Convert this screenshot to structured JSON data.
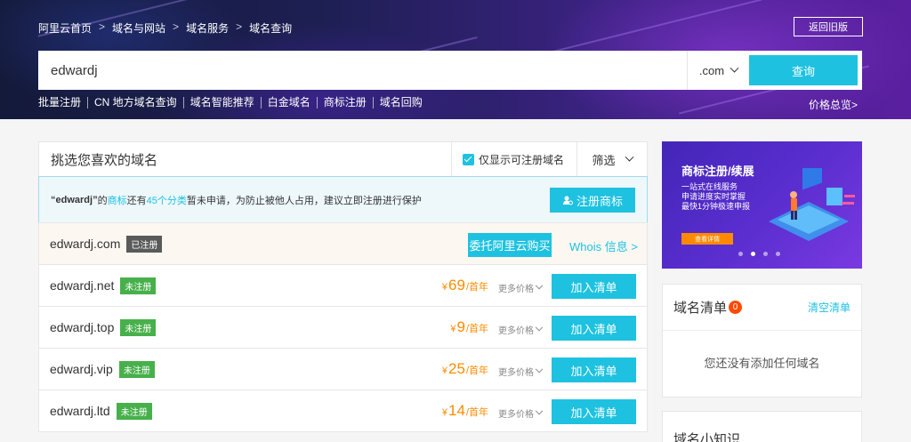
{
  "breadcrumb": [
    "阿里云首页",
    "域名与网站",
    "域名服务",
    "域名查询"
  ],
  "breadcrumb_sep": ">",
  "old_version_label": "返回旧版",
  "search": {
    "value": "edwardj",
    "tld": ".com",
    "button": "查询"
  },
  "quick_links": [
    "批量注册",
    "CN 地方域名查询",
    "域名智能推荐",
    "白金域名",
    "商标注册",
    "域名回购"
  ],
  "price_overview": "价格总览>",
  "filter": {
    "title": "挑选您喜欢的域名",
    "only_available": "仅显示可注册域名",
    "filter_label": "筛选"
  },
  "notice": {
    "quote": "“edwardj”",
    "t1": "的",
    "link1": "商标",
    "t2": "还有",
    "link2": "45个分类",
    "t3": "暂未申请，为防止被他人占用，建议立即注册进行保护",
    "button": "注册商标"
  },
  "taken_row": {
    "domain": "edwardj.com",
    "tag": "已注册",
    "entrust": "委托阿里云购买",
    "whois": "Whois 信息 >"
  },
  "rows": [
    {
      "domain": "edwardj.net",
      "tag": "未注册",
      "currency": "¥",
      "price": "69",
      "unit": "/首年",
      "more": "更多价格",
      "add": "加入清单"
    },
    {
      "domain": "edwardj.top",
      "tag": "未注册",
      "currency": "¥",
      "price": "9",
      "unit": "/首年",
      "more": "更多价格",
      "add": "加入清单"
    },
    {
      "domain": "edwardj.vip",
      "tag": "未注册",
      "currency": "¥",
      "price": "25",
      "unit": "/首年",
      "more": "更多价格",
      "add": "加入清单"
    },
    {
      "domain": "edwardj.ltd",
      "tag": "未注册",
      "currency": "¥",
      "price": "14",
      "unit": "/首年",
      "more": "更多价格",
      "add": "加入清单"
    }
  ],
  "ad": {
    "title": "商标注册/续展",
    "lines": [
      "一站式在线服务",
      "申请进度实时掌握",
      "最快1分钟极速申报"
    ],
    "button": "查看详情",
    "slides": 4,
    "active_slide": 2
  },
  "cart": {
    "title": "域名清单",
    "count": "0",
    "clear": "清空清单",
    "empty": "您还没有添加任何域名"
  },
  "tips": {
    "title": "域名小知识"
  },
  "colors": {
    "accent": "#1ec2e0",
    "price": "#ff8a00",
    "available": "#47b04b",
    "registered": "#5a5a5a"
  }
}
